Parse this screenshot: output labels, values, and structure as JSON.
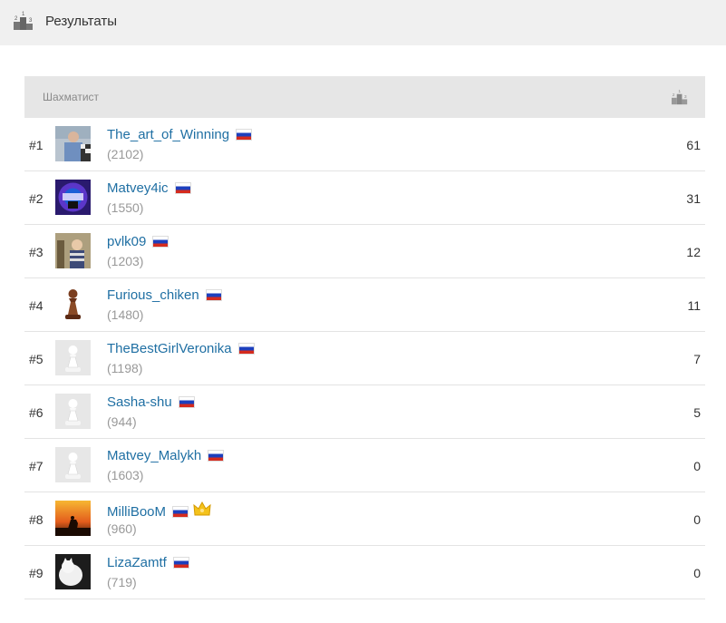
{
  "header": {
    "title": "Результаты",
    "icon": "podium-icon"
  },
  "table": {
    "col_player": "Шахматист",
    "col_score_icon": "podium-icon",
    "rows": [
      {
        "rank": "#1",
        "name": "The_art_of_Winning",
        "rating": "(2102)",
        "score": "61",
        "avatar": "photo-man",
        "crown": false
      },
      {
        "rank": "#2",
        "name": "Matvey4ic",
        "rating": "(1550)",
        "score": "31",
        "avatar": "purple-badge",
        "crown": false
      },
      {
        "rank": "#3",
        "name": "pvlk09",
        "rating": "(1203)",
        "score": "12",
        "avatar": "photo-child",
        "crown": false
      },
      {
        "rank": "#4",
        "name": "Furious_chiken",
        "rating": "(1480)",
        "score": "11",
        "avatar": "brown-pawn",
        "crown": false
      },
      {
        "rank": "#5",
        "name": "TheBestGirlVeronika",
        "rating": "(1198)",
        "score": "7",
        "avatar": "default-pawn",
        "crown": false
      },
      {
        "rank": "#6",
        "name": "Sasha-shu",
        "rating": "(944)",
        "score": "5",
        "avatar": "default-pawn",
        "crown": false
      },
      {
        "rank": "#7",
        "name": "Matvey_Malykh",
        "rating": "(1603)",
        "score": "0",
        "avatar": "default-pawn",
        "crown": false
      },
      {
        "rank": "#8",
        "name": "MilliBooM",
        "rating": "(960)",
        "score": "0",
        "avatar": "sunset-photo",
        "crown": true
      },
      {
        "rank": "#9",
        "name": "LizaZamtf",
        "rating": "(719)",
        "score": "0",
        "avatar": "white-cat",
        "crown": false
      }
    ]
  },
  "colors": {
    "link": "#1f6fa3",
    "header_bg": "#f0f0f0",
    "thead_bg": "#e6e6e6",
    "muted": "#999999"
  }
}
